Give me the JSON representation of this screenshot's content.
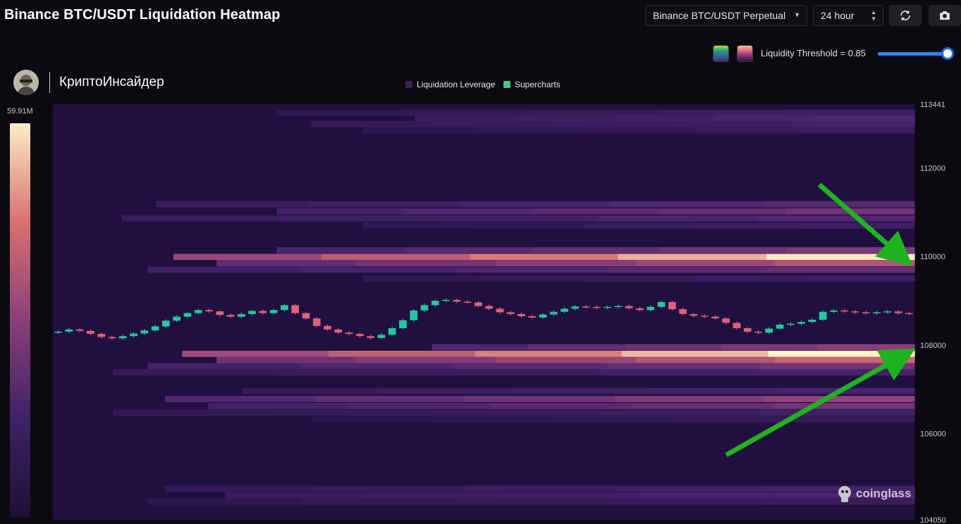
{
  "header": {
    "title": "Binance BTC/USDT Liquidation Heatmap"
  },
  "controls": {
    "pair_select": "Binance BTC/USDT Perpetual",
    "range_select": "24 hour",
    "refresh_icon": "refresh-icon",
    "camera_icon": "camera-icon",
    "threshold_label": "Liquidity Threshold = 0.85",
    "threshold_value": 0.85,
    "palette_icons": [
      "viridis-palette-icon",
      "magma-palette-icon"
    ]
  },
  "brand": {
    "name": "КриптоИнсайдер"
  },
  "legend": [
    {
      "label": "Liquidation Leverage",
      "color": "#3b1f5c"
    },
    {
      "label": "Supercharts",
      "color": "#4cc77f"
    }
  ],
  "watermark": {
    "text": "coinglass"
  },
  "colors": {
    "up": "#26c6a0",
    "down": "#e0607a",
    "bg": "#20103f",
    "hot": "#fff3c8"
  },
  "chart_data": {
    "type": "heatmap",
    "title": "Binance BTC/USDT Liquidation Heatmap",
    "ylim": [
      104050,
      113441
    ],
    "y_ticks": [
      "113441",
      "112000",
      "110000",
      "108000",
      "106000",
      "104050"
    ],
    "colorbar": {
      "max_label": "59.91M",
      "max_value": 59910000
    },
    "liquidation_levels": [
      {
        "price": 113250,
        "intensity": 0.18,
        "start": 0.26
      },
      {
        "price": 113120,
        "intensity": 0.28,
        "start": 0.42
      },
      {
        "price": 112990,
        "intensity": 0.22,
        "start": 0.3
      },
      {
        "price": 112850,
        "intensity": 0.16,
        "start": 0.36
      },
      {
        "price": 111180,
        "intensity": 0.3,
        "start": 0.12
      },
      {
        "price": 111020,
        "intensity": 0.4,
        "start": 0.26
      },
      {
        "price": 110860,
        "intensity": 0.28,
        "start": 0.08
      },
      {
        "price": 110700,
        "intensity": 0.18,
        "start": 0.36
      },
      {
        "price": 110140,
        "intensity": 0.45,
        "start": 0.26
      },
      {
        "price": 109990,
        "intensity": 0.98,
        "start": 0.14
      },
      {
        "price": 109850,
        "intensity": 0.62,
        "start": 0.19
      },
      {
        "price": 109700,
        "intensity": 0.35,
        "start": 0.11
      },
      {
        "price": 109500,
        "intensity": 0.18,
        "start": 0.36
      },
      {
        "price": 107950,
        "intensity": 0.5,
        "start": 0.44
      },
      {
        "price": 107800,
        "intensity": 1.0,
        "start": 0.15
      },
      {
        "price": 107660,
        "intensity": 0.7,
        "start": 0.19
      },
      {
        "price": 107520,
        "intensity": 0.4,
        "start": 0.11
      },
      {
        "price": 107380,
        "intensity": 0.22,
        "start": 0.07
      },
      {
        "price": 106960,
        "intensity": 0.24,
        "start": 0.22
      },
      {
        "price": 106780,
        "intensity": 0.52,
        "start": 0.13
      },
      {
        "price": 106620,
        "intensity": 0.4,
        "start": 0.18
      },
      {
        "price": 106470,
        "intensity": 0.2,
        "start": 0.07
      },
      {
        "price": 106320,
        "intensity": 0.14,
        "start": 0.3
      },
      {
        "price": 104750,
        "intensity": 0.22,
        "start": 0.13
      },
      {
        "price": 104600,
        "intensity": 0.26,
        "start": 0.2
      },
      {
        "price": 104460,
        "intensity": 0.16,
        "start": 0.11
      }
    ],
    "price_series": [
      108300,
      108350,
      108320,
      108250,
      108180,
      108150,
      108200,
      108260,
      108330,
      108420,
      108550,
      108640,
      108720,
      108790,
      108760,
      108680,
      108640,
      108700,
      108770,
      108720,
      108790,
      108900,
      108720,
      108600,
      108430,
      108350,
      108280,
      108250,
      108200,
      108160,
      108230,
      108380,
      108560,
      108780,
      108900,
      109000,
      109020,
      108980,
      108960,
      108880,
      108820,
      108740,
      108700,
      108650,
      108620,
      108690,
      108750,
      108820,
      108870,
      108860,
      108840,
      108860,
      108880,
      108830,
      108790,
      108860,
      108970,
      108810,
      108700,
      108660,
      108640,
      108600,
      108500,
      108380,
      108300,
      108280,
      108370,
      108460,
      108480,
      108520,
      108570,
      108750,
      108780,
      108760,
      108740,
      108720,
      108740,
      108760,
      108720,
      108700
    ]
  }
}
